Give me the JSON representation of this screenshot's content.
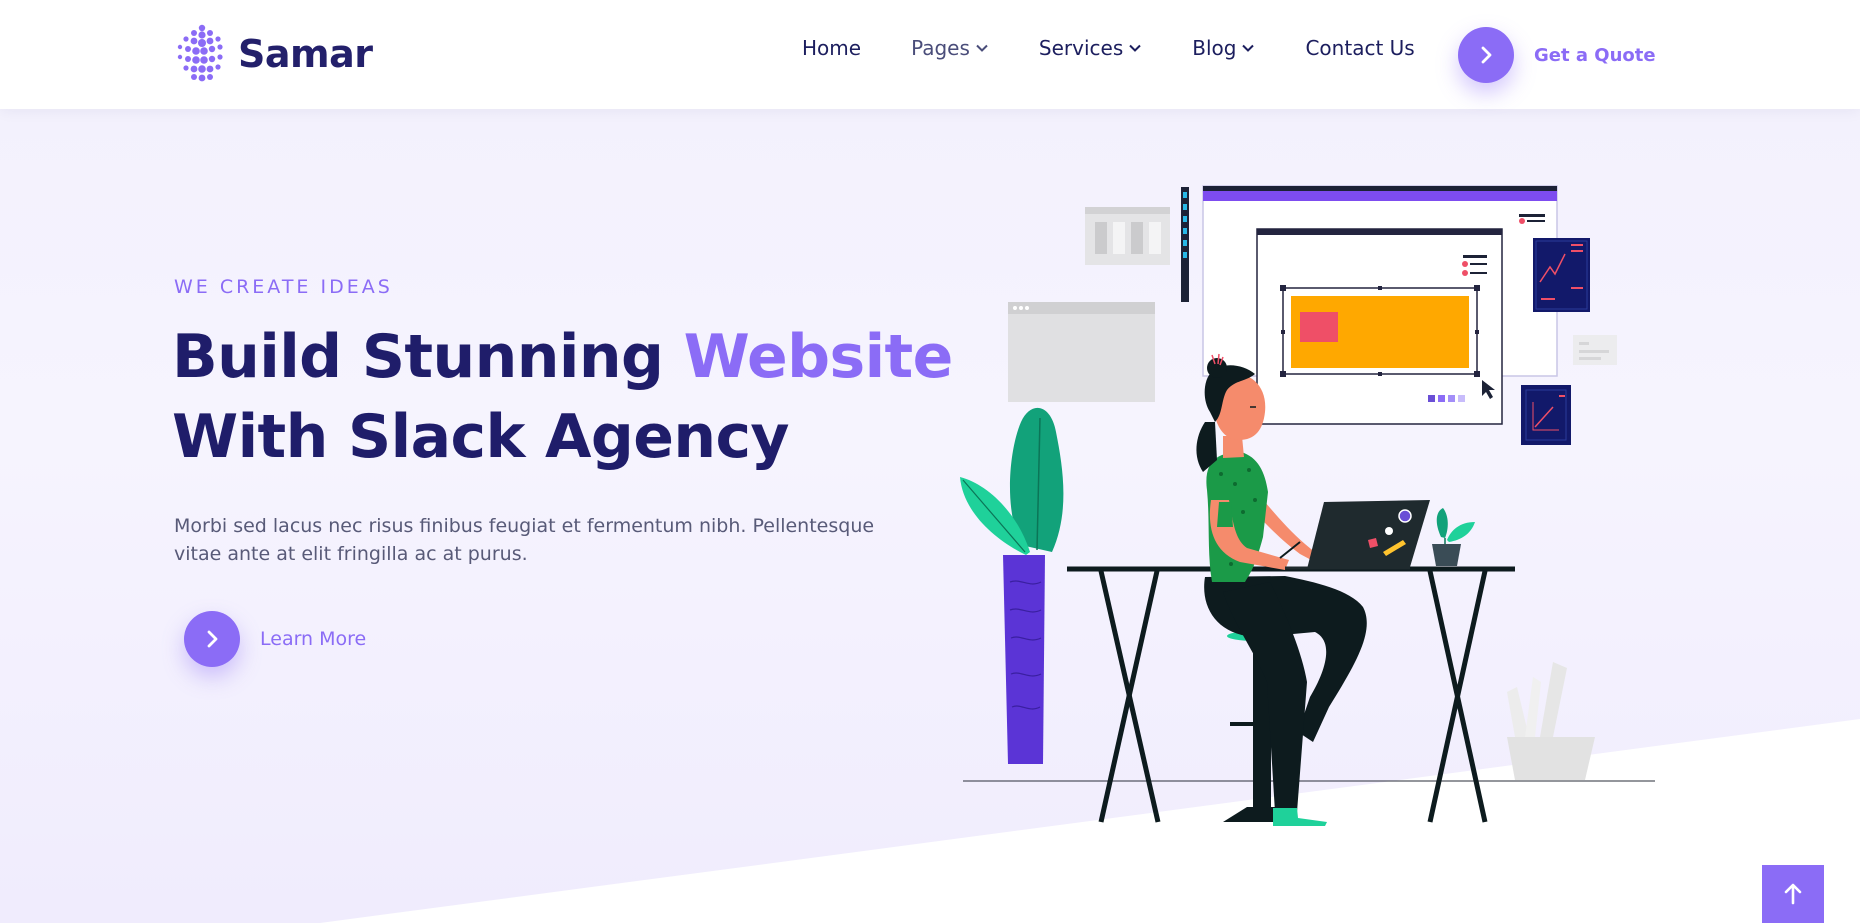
{
  "header": {
    "brand": "Samar",
    "nav": [
      {
        "label": "Home",
        "has_dropdown": false
      },
      {
        "label": "Pages",
        "has_dropdown": true
      },
      {
        "label": "Services",
        "has_dropdown": true
      },
      {
        "label": "Blog",
        "has_dropdown": true
      },
      {
        "label": "Contact Us",
        "has_dropdown": false
      }
    ],
    "cta_label": "Get a Quote",
    "cta_icon": "chevron-right-icon"
  },
  "hero": {
    "eyebrow": "WE CREATE IDEAS",
    "headline_part1": "Build Stunning ",
    "headline_accent": "Website",
    "headline_part2": "With Slack Agency",
    "description": "Morbi sed lacus nec risus finibus feugiat et fermentum nibh. Pellentesque vitae ante at elit fringilla ac at purus.",
    "learn_more_label": "Learn More",
    "learn_more_icon": "chevron-right-icon"
  },
  "scroll_top": {
    "icon": "arrow-up-icon"
  },
  "colors": {
    "accent": "#8b6cf6",
    "heading": "#1f1d6a",
    "nav_text": "#1c1e5e",
    "body_text": "#585a78",
    "hero_bg": "#f3f1fd"
  }
}
